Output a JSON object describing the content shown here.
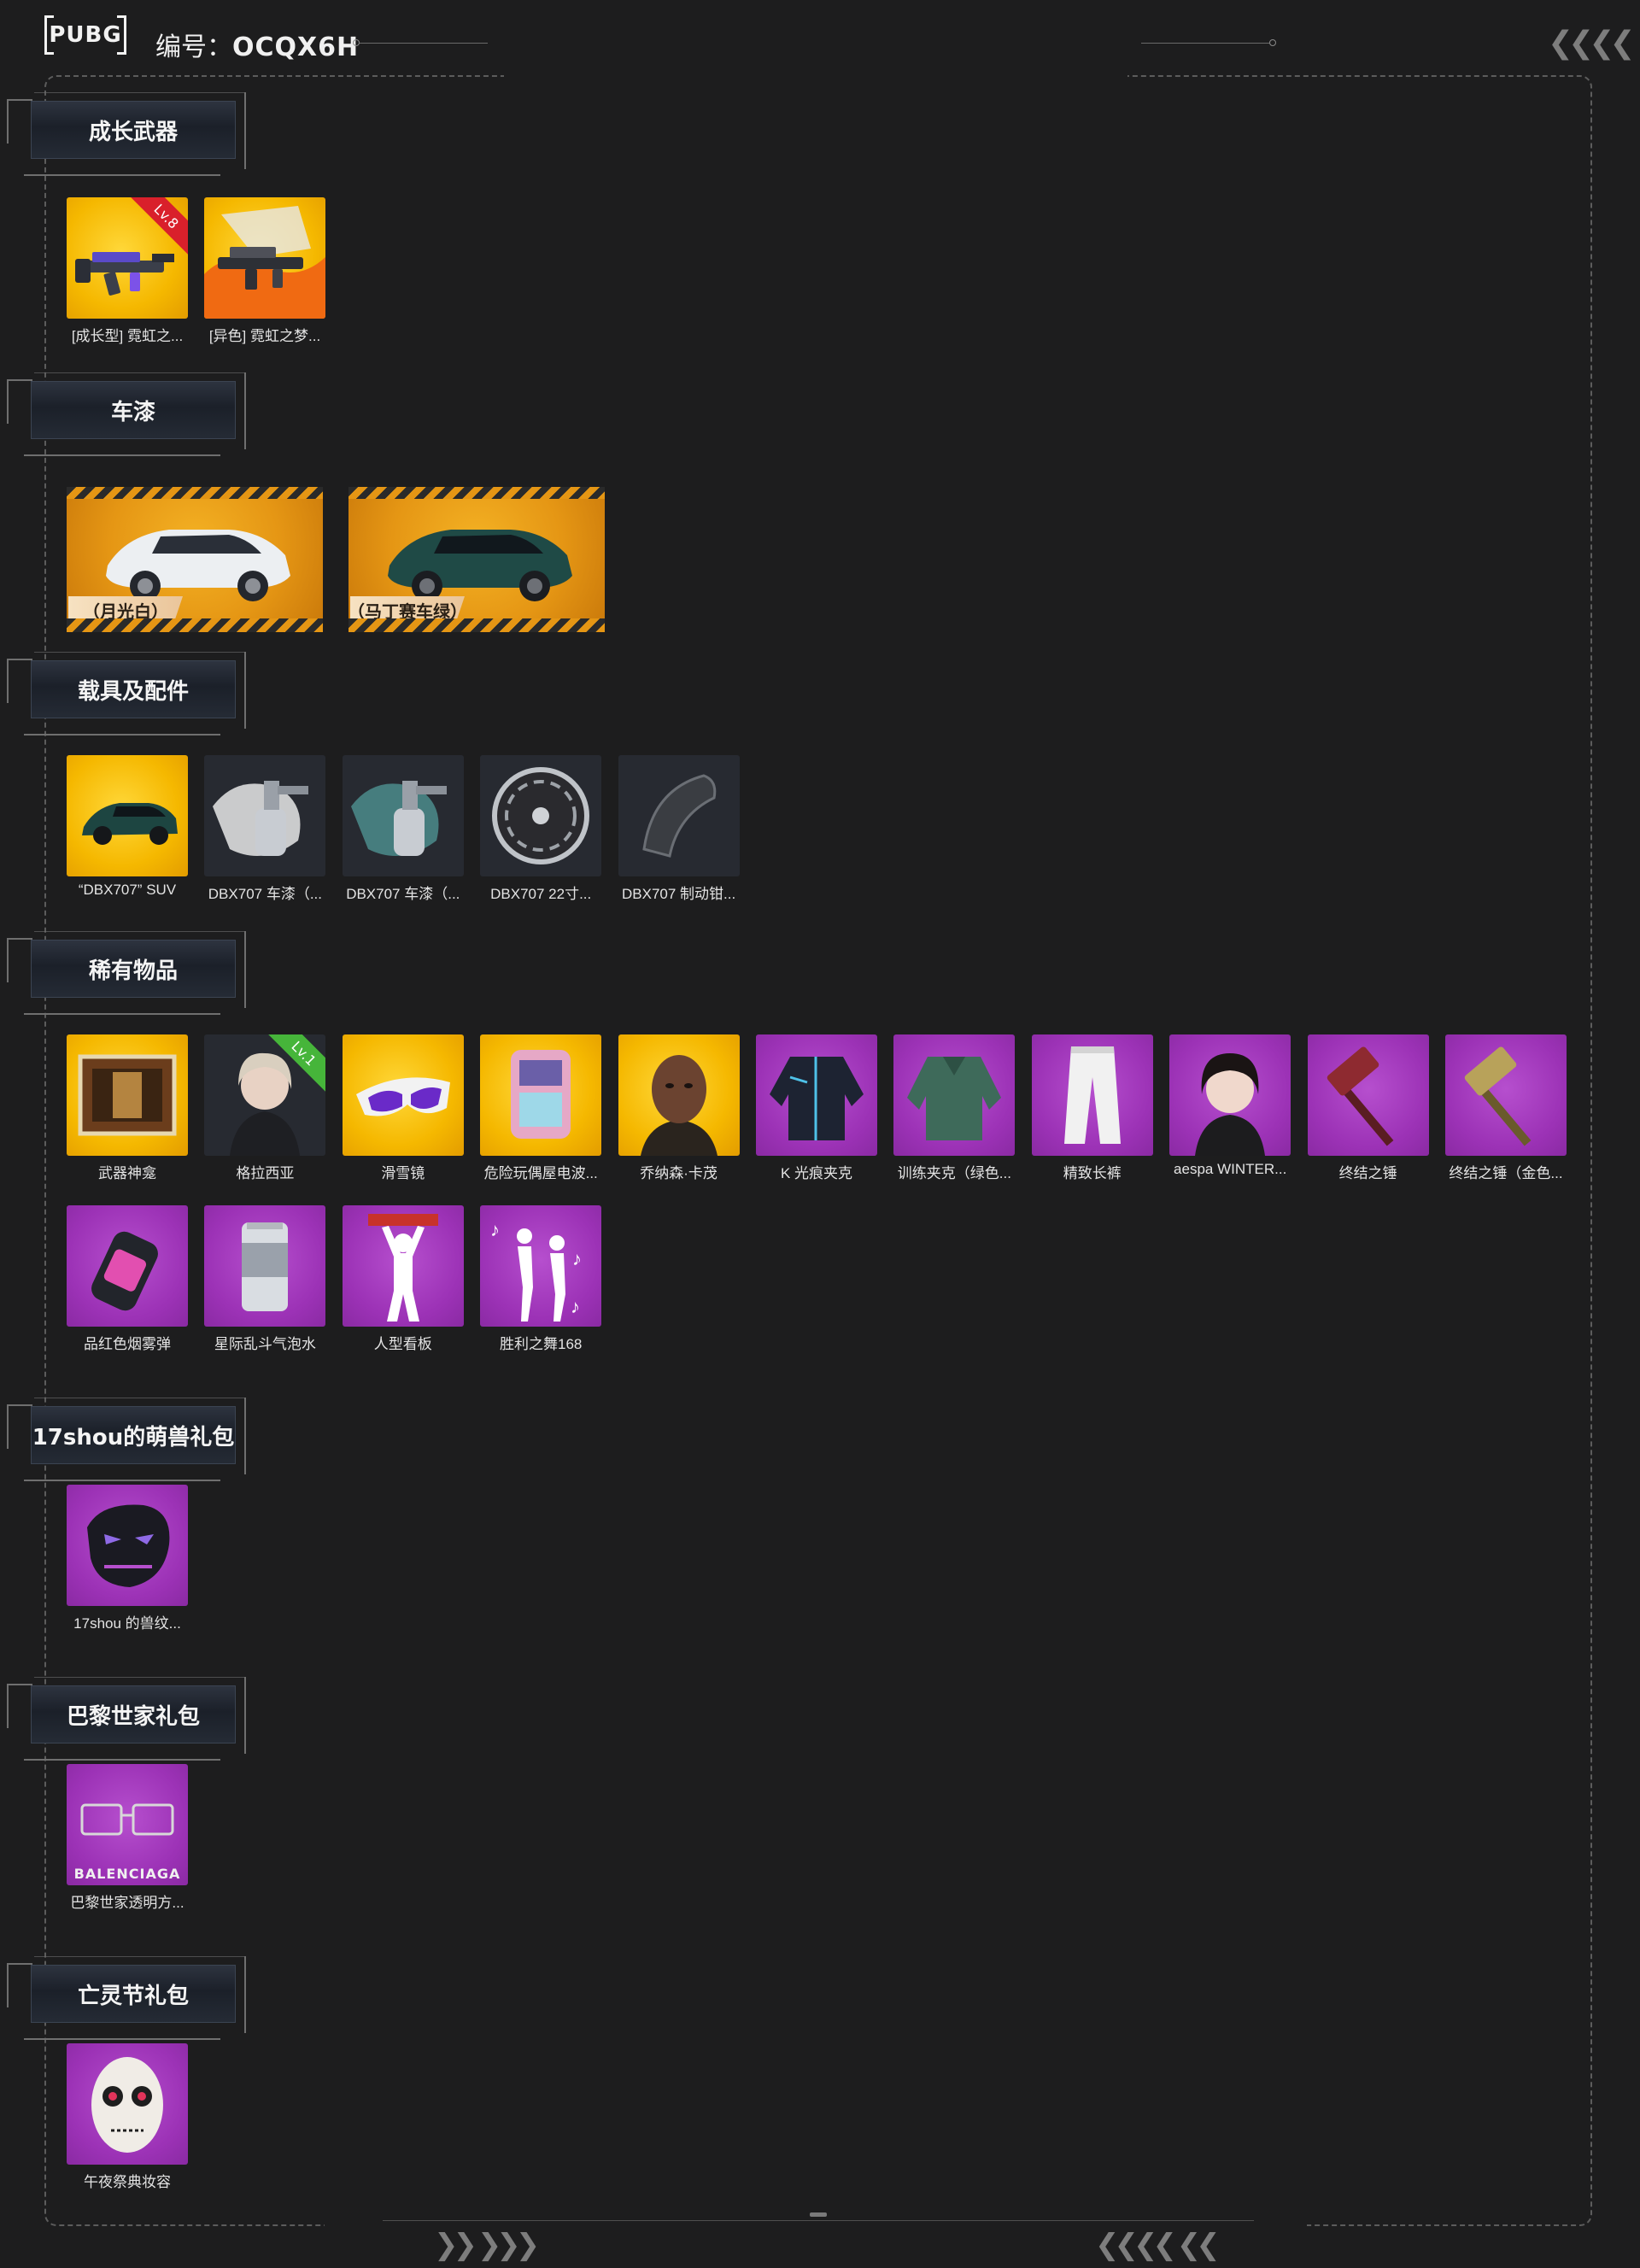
{
  "header": {
    "logo_text": "PUBG",
    "id_label": "编号：",
    "id_value": "OCQX6H"
  },
  "sections": [
    {
      "title": "成长武器",
      "items": [
        {
          "label": "[成长型] 霓虹之...",
          "bg": "gold",
          "badge": "Lv.8",
          "badge_color": "red",
          "icon": "neon-rifle-icon"
        },
        {
          "label": "[异色] 霓虹之梦...",
          "bg": "gold",
          "icon": "neon-rifle-alt-icon"
        }
      ]
    },
    {
      "title": "车漆",
      "vehicles": [
        {
          "label": "（月光白）",
          "color": "#e9ecef",
          "icon": "suv-white-icon"
        },
        {
          "label": "（马丁赛车绿）",
          "color": "#1f4a46",
          "icon": "suv-green-icon"
        }
      ]
    },
    {
      "title": "载具及配件",
      "items": [
        {
          "label": "“DBX707” SUV",
          "bg": "gold",
          "icon": "suv-icon"
        },
        {
          "label": "DBX707 车漆（...",
          "bg": "dark",
          "icon": "spray-gun-white-icon"
        },
        {
          "label": "DBX707 车漆（...",
          "bg": "dark",
          "icon": "spray-gun-teal-icon"
        },
        {
          "label": "DBX707 22寸...",
          "bg": "dark",
          "icon": "wheel-rim-icon"
        },
        {
          "label": "DBX707 制动钳...",
          "bg": "dark",
          "icon": "brake-caliper-icon"
        }
      ]
    },
    {
      "title": "稀有物品",
      "items": [
        {
          "label": "武器神龛",
          "bg": "gold",
          "icon": "weapon-shrine-icon"
        },
        {
          "label": "格拉西亚",
          "bg": "dark",
          "badge": "Lv.1",
          "badge_color": "green",
          "icon": "character-gracia-icon"
        },
        {
          "label": "滑雪镜",
          "bg": "gold",
          "icon": "ski-goggles-icon"
        },
        {
          "label": "危险玩偶屋电波...",
          "bg": "gold",
          "icon": "backpack-radio-icon"
        },
        {
          "label": "乔纳森·卡茂",
          "bg": "gold",
          "icon": "character-jonathan-icon"
        },
        {
          "label": "K 光痕夹克",
          "bg": "purple",
          "icon": "jacket-icon"
        },
        {
          "label": "训练夹克（绿色...",
          "bg": "purple",
          "icon": "green-jacket-icon"
        },
        {
          "label": "精致长裤",
          "bg": "purple",
          "icon": "white-pants-icon"
        },
        {
          "label": "aespa WINTER...",
          "bg": "purple",
          "icon": "character-winter-icon"
        },
        {
          "label": "终结之锤",
          "bg": "purple",
          "icon": "hammer-icon"
        },
        {
          "label": "终结之锤（金色...",
          "bg": "purple",
          "icon": "gold-hammer-icon"
        },
        {
          "label": "品红色烟雾弹",
          "bg": "purple",
          "icon": "smoke-grenade-icon"
        },
        {
          "label": "星际乱斗气泡水",
          "bg": "purple",
          "icon": "soda-can-icon"
        },
        {
          "label": "人型看板",
          "bg": "purple",
          "icon": "emote-sign-icon"
        },
        {
          "label": "胜利之舞168",
          "bg": "purple",
          "icon": "emote-dance-icon"
        }
      ]
    },
    {
      "title": "17shou的萌兽礼包",
      "items": [
        {
          "label": "17shou 的兽纹...",
          "bg": "purple",
          "icon": "beast-mask-icon"
        }
      ]
    },
    {
      "title": "巴黎世家礼包",
      "items": [
        {
          "label": "巴黎世家透明方...",
          "bg": "purple",
          "icon": "glasses-icon",
          "brand_text": "BALENCIAGA"
        }
      ]
    },
    {
      "title": "亡灵节礼包",
      "items": [
        {
          "label": "午夜祭典妆容",
          "bg": "purple",
          "icon": "sugar-skull-face-icon"
        }
      ]
    }
  ]
}
